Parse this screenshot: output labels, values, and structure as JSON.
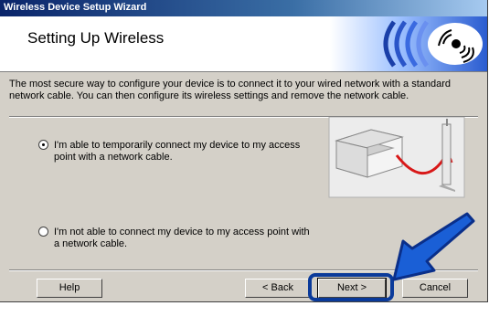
{
  "window": {
    "title": "Wireless Device Setup Wizard",
    "heading": "Setting Up Wireless"
  },
  "intro_text": "The most secure way to configure your device is to connect it to your wired network with a standard network cable. You can then configure its wireless settings and remove the network cable.",
  "options": [
    {
      "line1": "I'm able to temporarily connect my device to my access",
      "line2": "point with a network cable.",
      "selected": true
    },
    {
      "line1": "I'm not able to connect my device to my access point with",
      "line2": "a network cable.",
      "selected": false
    }
  ],
  "buttons": {
    "help": "Help",
    "back": "< Back",
    "next": "Next >",
    "cancel": "Cancel"
  },
  "colors": {
    "highlight": "#0a3a9a",
    "arrow": "#1a5fd6",
    "cable": "#d81818"
  }
}
